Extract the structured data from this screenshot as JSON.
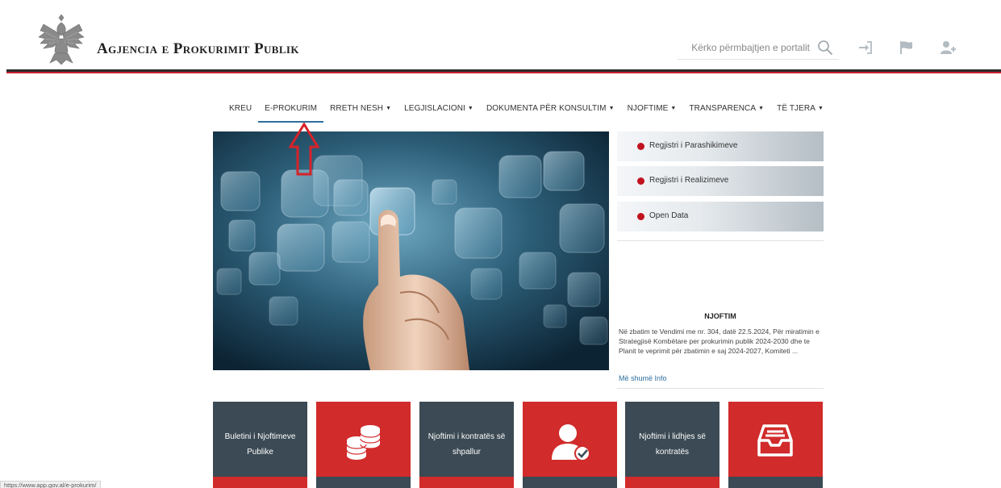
{
  "header": {
    "site_title": "Agjencia e Prokurimit Publik",
    "search_placeholder": "Kërko përmbajtjen e portalit",
    "icons": [
      "search-icon",
      "sign-in-icon",
      "flag-icon",
      "add-user-icon"
    ]
  },
  "nav": {
    "items": [
      {
        "label": "KREU",
        "dropdown": false
      },
      {
        "label": "E-PROKURIM",
        "dropdown": false,
        "active": true
      },
      {
        "label": "RRETH NESH",
        "dropdown": true
      },
      {
        "label": "LEGJISLACIONI",
        "dropdown": true
      },
      {
        "label": "DOKUMENTA PËR KONSULTIM",
        "dropdown": true
      },
      {
        "label": "NJOFTIME",
        "dropdown": true
      },
      {
        "label": "TRANSPARENCA",
        "dropdown": true
      },
      {
        "label": "TË TJERA",
        "dropdown": true
      }
    ],
    "caret": "▼"
  },
  "side_links": [
    {
      "label": "Regjistri i Parashikimeve"
    },
    {
      "label": "Regjistri i Realizimeve"
    },
    {
      "label": "Open Data"
    }
  ],
  "notice": {
    "title": "NJOFTIM",
    "text": "Në zbatim te Vendimi me nr. 304, datë 22.5.2024, Për miratimin e Strategjisë Kombëtare per prokurimin publik 2024-2030 dhe te Planit te veprimit për zbatimin e saj 2024-2027, Komiteti ...",
    "more_label": "Më shumë Info"
  },
  "tiles": [
    {
      "label": "Buletini i Njoftimeve Publike",
      "style": "dark"
    },
    {
      "icon": "coins-icon",
      "style": "red"
    },
    {
      "label": "Njoftimi i kontratës së shpallur",
      "style": "dark"
    },
    {
      "icon": "user-check-icon",
      "style": "red"
    },
    {
      "label": "Njoftimi i lidhjes së kontratës",
      "style": "dark"
    },
    {
      "icon": "inbox-tray-icon",
      "style": "red"
    }
  ],
  "status_bar": {
    "url": "https://www.app.gov.al/e-prokurim/"
  },
  "colors": {
    "accent_red": "#d12b2b",
    "tile_dark": "#3b4a54",
    "link_blue": "#2c6f9e",
    "dot_red": "#c1121f"
  }
}
